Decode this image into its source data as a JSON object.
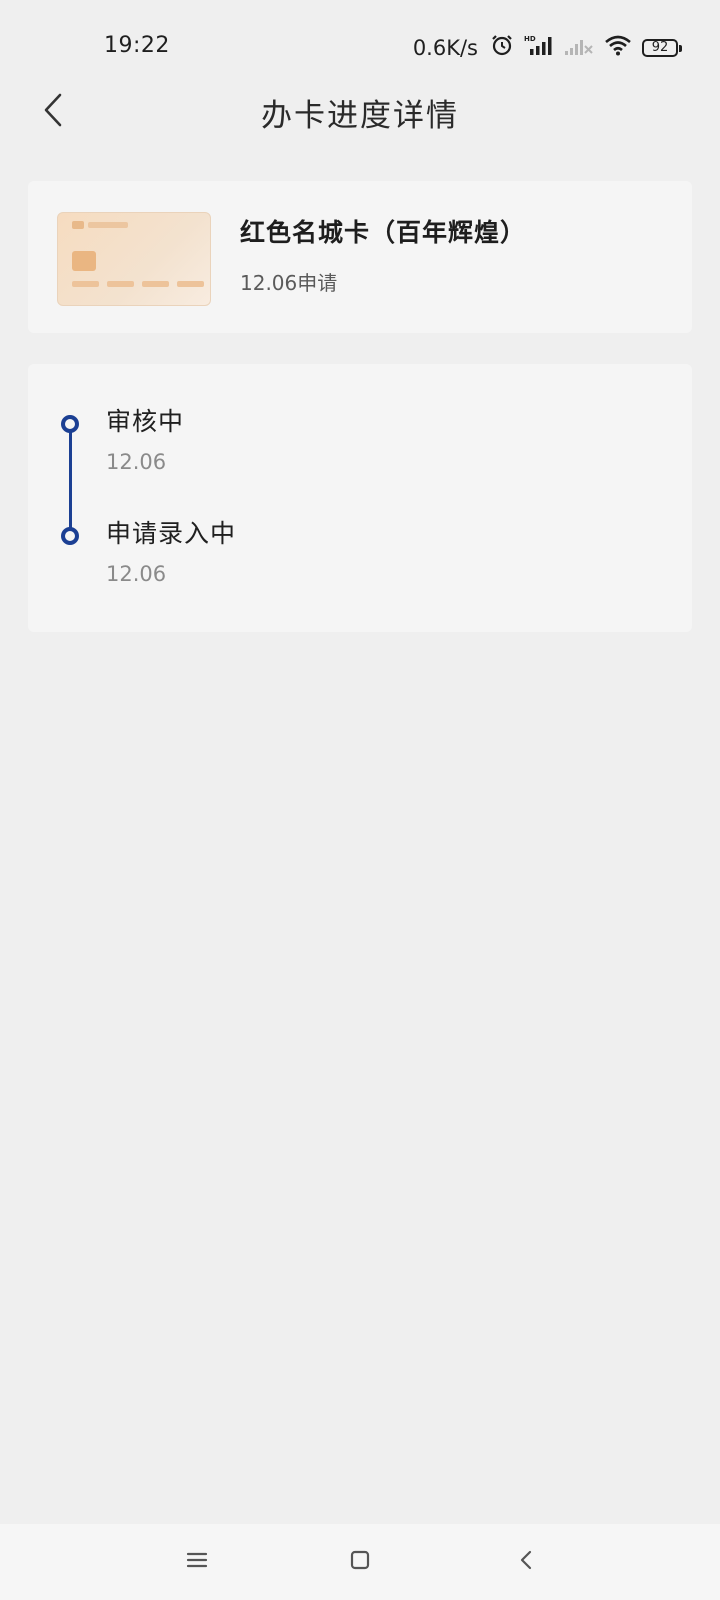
{
  "status_bar": {
    "time": "19:22",
    "net_speed": "0.6K/s",
    "battery": "92",
    "icons": [
      "alarm-icon",
      "hd-signal-icon",
      "signal-off-icon",
      "wifi-icon",
      "battery-icon"
    ]
  },
  "header": {
    "title": "办卡进度详情",
    "back_icon": "chevron-left-icon"
  },
  "card": {
    "name": "红色名城卡（百年辉煌）",
    "apply_date": "12.06申请",
    "thumbnail_colors": {
      "base": "#f6dcc0",
      "chip": "#eab682"
    }
  },
  "timeline": {
    "accent_color": "#1b3f93",
    "steps": [
      {
        "label": "审核中",
        "date": "12.06"
      },
      {
        "label": "申请录入中",
        "date": "12.06"
      }
    ]
  },
  "nav_bar": {
    "buttons": [
      "menu-icon",
      "home-icon",
      "back-icon"
    ]
  }
}
